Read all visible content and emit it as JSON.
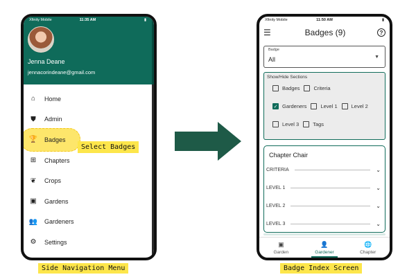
{
  "left_phone": {
    "status": {
      "carrier": "Xfinity Mobile",
      "time": "11:35 AM"
    },
    "user": {
      "name": "Jenna Deane",
      "email": "jennacorindeane@gmail.com"
    },
    "menu_items": [
      {
        "label": "Home",
        "icon": "home-icon",
        "glyph": "⌂"
      },
      {
        "label": "Admin",
        "icon": "admin-shield-icon",
        "glyph": "⛊"
      },
      {
        "label": "Badges",
        "icon": "trophy-icon",
        "glyph": "🏆"
      },
      {
        "label": "Chapters",
        "icon": "chapters-icon",
        "glyph": "⊞"
      },
      {
        "label": "Crops",
        "icon": "sprout-icon",
        "glyph": "❦"
      },
      {
        "label": "Gardens",
        "icon": "garden-icon",
        "glyph": "▣"
      },
      {
        "label": "Gardeners",
        "icon": "people-icon",
        "glyph": "👥"
      },
      {
        "label": "Settings",
        "icon": "gear-icon",
        "glyph": "⚙"
      }
    ],
    "callout": "Select Badges",
    "caption": "Side Navigation Menu"
  },
  "right_phone": {
    "status": {
      "carrier": "Xfinity Mobile",
      "time": "11:50 AM"
    },
    "title": "Badges (9)",
    "badge_select": {
      "label": "Badge",
      "value": "All"
    },
    "show_hide": {
      "label": "Show/Hide Sections",
      "options": [
        {
          "label": "Badges",
          "checked": false
        },
        {
          "label": "Criteria",
          "checked": false
        },
        {
          "label": "Gardeners",
          "checked": true
        },
        {
          "label": "Level 1",
          "checked": false
        },
        {
          "label": "Level 2",
          "checked": false
        },
        {
          "label": "Level 3",
          "checked": false
        },
        {
          "label": "Tags",
          "checked": false
        }
      ]
    },
    "card": {
      "title": "Chapter Chair",
      "rows": [
        "CRITERIA",
        "LEVEL 1",
        "LEVEL 2",
        "LEVEL 3"
      ]
    },
    "bottom_nav": [
      {
        "label": "Garden",
        "icon": "garden-icon",
        "glyph": "▣",
        "active": false
      },
      {
        "label": "Gardener",
        "icon": "person-icon",
        "glyph": "👤",
        "active": true
      },
      {
        "label": "Chapter",
        "icon": "globe-icon",
        "glyph": "🌐",
        "active": false
      }
    ],
    "caption": "Badge Index Screen"
  },
  "colors": {
    "accent": "#0f6b5a",
    "highlight": "#fde64b",
    "arrow": "#1e5a47"
  }
}
